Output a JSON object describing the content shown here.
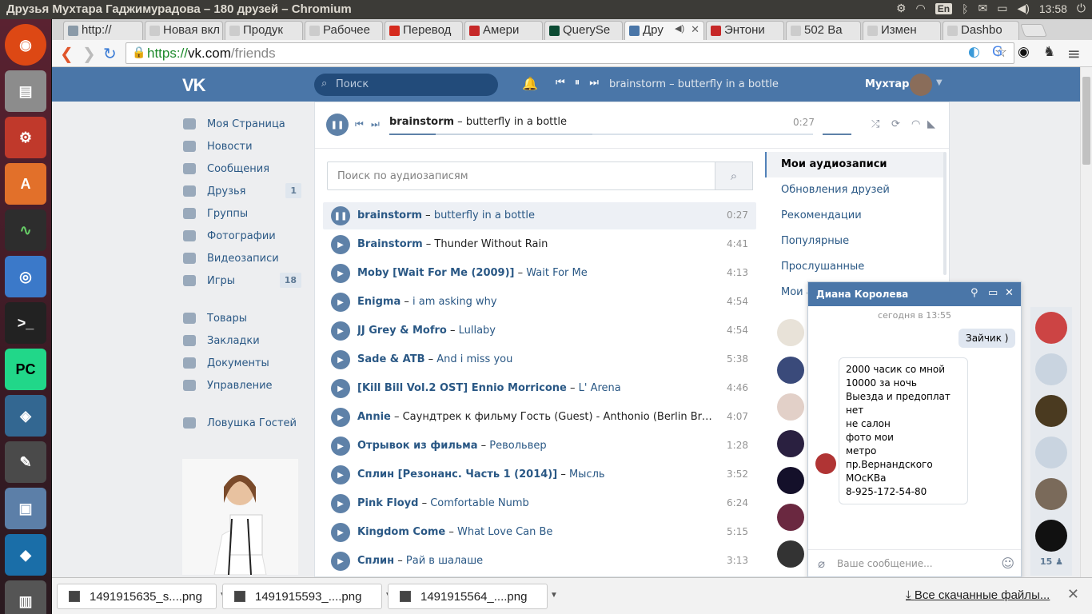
{
  "system": {
    "window_title": "Друзья Мухтара Гаджимурадова – 180 друзей – Chromium",
    "keyboard_layout": "En",
    "clock": "13:58"
  },
  "tabs": [
    {
      "label": "http://",
      "fav": "#8a9aa8"
    },
    {
      "label": "Новая вкл",
      "fav": "#cccccc"
    },
    {
      "label": "Продук",
      "fav": "#cccccc"
    },
    {
      "label": "Рабочее",
      "fav": "#cccccc"
    },
    {
      "label": "Перевод",
      "fav": "#d52b1e"
    },
    {
      "label": "Амери",
      "fav": "#c62828"
    },
    {
      "label": "QuerySe",
      "fav": "#0c4b33"
    },
    {
      "label": "Дру",
      "fav": "#4a76a8"
    },
    {
      "label": "Энтони",
      "fav": "#c62828"
    },
    {
      "label": "502 Ba",
      "fav": "#cccccc"
    },
    {
      "label": "Измен",
      "fav": "#cccccc"
    },
    {
      "label": "Dashbo",
      "fav": "#cccccc"
    }
  ],
  "address": {
    "scheme": "https://",
    "domain": "vk.com",
    "path": "/friends"
  },
  "vk_header": {
    "logo": "VK",
    "search_placeholder": "Поиск",
    "now_playing": "brainstorm – butterfly in a bottle",
    "user": "Мухтар"
  },
  "left_nav": [
    {
      "label": "Моя Страница",
      "count": ""
    },
    {
      "label": "Новости",
      "count": ""
    },
    {
      "label": "Сообщения",
      "count": ""
    },
    {
      "label": "Друзья",
      "count": "1"
    },
    {
      "label": "Группы",
      "count": ""
    },
    {
      "label": "Фотографии",
      "count": ""
    },
    {
      "label": "Видеозаписи",
      "count": ""
    },
    {
      "label": "Игры",
      "count": "18"
    },
    {
      "label": "Товары",
      "count": ""
    },
    {
      "label": "Закладки",
      "count": ""
    },
    {
      "label": "Документы",
      "count": ""
    },
    {
      "label": "Управление",
      "count": ""
    },
    {
      "label": "Ловушка Гостей",
      "count": ""
    }
  ],
  "player": {
    "artist": "brainstorm",
    "title": "butterfly in a bottle",
    "time": "0:27",
    "progress": 0.11,
    "buffered": 0.48
  },
  "audio_search_placeholder": "Поиск по аудиозаписям",
  "tracks": [
    {
      "artist": "brainstorm",
      "title": "butterfly in a bottle",
      "duration": "0:27",
      "current": true,
      "title_dark": false
    },
    {
      "artist": "Brainstorm",
      "title": "Thunder Without Rain",
      "duration": "4:41",
      "current": false,
      "title_dark": true
    },
    {
      "artist": "Moby [Wait For Me (2009)]",
      "title": "Wait For Me",
      "duration": "4:13",
      "current": false,
      "title_dark": false
    },
    {
      "artist": "Enigma",
      "title": "i am asking why",
      "duration": "4:54",
      "current": false,
      "title_dark": false
    },
    {
      "artist": "JJ Grey & Mofro",
      "title": "Lullaby",
      "duration": "4:54",
      "current": false,
      "title_dark": false
    },
    {
      "artist": "Sade & ATB",
      "title": "And i miss you",
      "duration": "5:38",
      "current": false,
      "title_dark": false
    },
    {
      "artist": "[Kill Bill Vol.2 OST] Ennio Morricone",
      "title": "L' Arena",
      "duration": "4:46",
      "current": false,
      "title_dark": false
    },
    {
      "artist": "Annie",
      "title": "Саундтрек к фильму Гость (Guest) - Anthonio (Berlin Breakdown Version)",
      "duration": "4:07",
      "current": false,
      "title_dark": true
    },
    {
      "artist": "Отрывок из фильма",
      "title": "Револьвер",
      "duration": "1:28",
      "current": false,
      "title_dark": false
    },
    {
      "artist": "Сплин [Резонанс. Часть 1 (2014)]",
      "title": "Мысль",
      "duration": "3:52",
      "current": false,
      "title_dark": false
    },
    {
      "artist": "Pink Floyd",
      "title": "Comfortable Numb",
      "duration": "6:24",
      "current": false,
      "title_dark": false
    },
    {
      "artist": "Kingdom Come",
      "title": "What Love Can Be",
      "duration": "5:15",
      "current": false,
      "title_dark": false
    },
    {
      "artist": "Сплин",
      "title": "Рай в шалаше",
      "duration": "3:13",
      "current": false,
      "title_dark": false
    }
  ],
  "audio_menu": [
    {
      "label": "Мои аудиозаписи",
      "selected": true
    },
    {
      "label": "Обновления друзей",
      "selected": false
    },
    {
      "label": "Рекомендации",
      "selected": false
    },
    {
      "label": "Популярные",
      "selected": false
    },
    {
      "label": "Прослушанные",
      "selected": false
    },
    {
      "label": "Мои а",
      "selected": false
    }
  ],
  "chat": {
    "name": "Диана Королева",
    "time": "сегодня в 13:55",
    "outgoing": "Зайчик )",
    "incoming": [
      "2000 часик со мной",
      "10000 за ночь",
      "Выезда и предоплат нет",
      "не салон",
      "фото мои",
      "метро пр.Вернандского",
      "МОсКВа",
      "8-925-172-54-80"
    ],
    "input_placeholder": "Ваше сообщение..."
  },
  "chat_sidebar_count": "15",
  "downloads": [
    {
      "name": "1491915635_s....png"
    },
    {
      "name": "1491915593_....png"
    },
    {
      "name": "1491915564_....png"
    }
  ],
  "downloads_all": "Все скачанные файлы...",
  "colors": {
    "vk_blue": "#4a76a8",
    "link": "#2a5885",
    "play": "#5e81a8"
  }
}
